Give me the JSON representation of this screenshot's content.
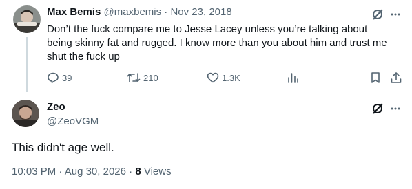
{
  "quoted_post": {
    "author_name": "Max Bemis",
    "author_handle": "@maxbemis",
    "separator": " · ",
    "date": "Nov 23, 2018",
    "text": "Don’t the fuck compare me to Jesse Lacey unless you’re talking about being skinny fat and rugged. I know more than you about him and trust me shut the fuck up",
    "replies": "39",
    "reposts": "210",
    "likes": "1.3K"
  },
  "reply_post": {
    "author_name": "Zeo",
    "author_handle": "@ZeoVGM",
    "text": "This didn't age well.",
    "time": "10:03 PM",
    "separator": " · ",
    "date": "Aug 30, 2026",
    "separator2": " · ",
    "views_count": "8",
    "views_label": " Views"
  },
  "colors": {
    "text_primary": "#0f1419",
    "text_secondary": "#536471",
    "thread_line": "#cfd9de"
  }
}
